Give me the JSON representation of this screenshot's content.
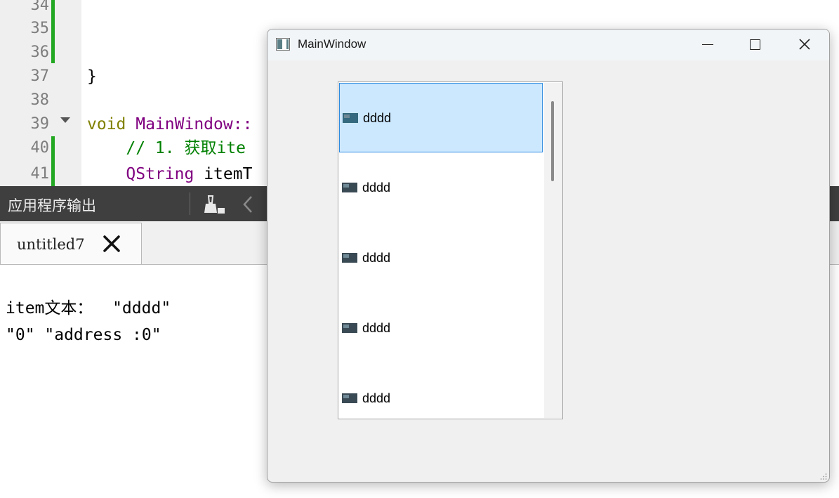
{
  "editor": {
    "line_numbers": [
      "34",
      "35",
      "36",
      "37",
      "38",
      "39",
      "40",
      "41"
    ],
    "line_37_text": "}",
    "line_39": {
      "keyword": "void",
      "name": "MainWindow::"
    },
    "line_40_comment": "// 1. 获取ite",
    "line_41": {
      "type": "QString",
      "rest": "itemT"
    }
  },
  "output_pane": {
    "title": "应用程序输出",
    "tab_label": "untitled7",
    "lines": [
      "item文本：  \"dddd\"",
      "\"0\" \"address :0\""
    ]
  },
  "window": {
    "title": "MainWindow",
    "list_items": [
      {
        "label": "dddd",
        "selected": true
      },
      {
        "label": "dddd",
        "selected": false
      },
      {
        "label": "dddd",
        "selected": false
      },
      {
        "label": "dddd",
        "selected": false
      },
      {
        "label": "dddd",
        "selected": false
      }
    ]
  }
}
